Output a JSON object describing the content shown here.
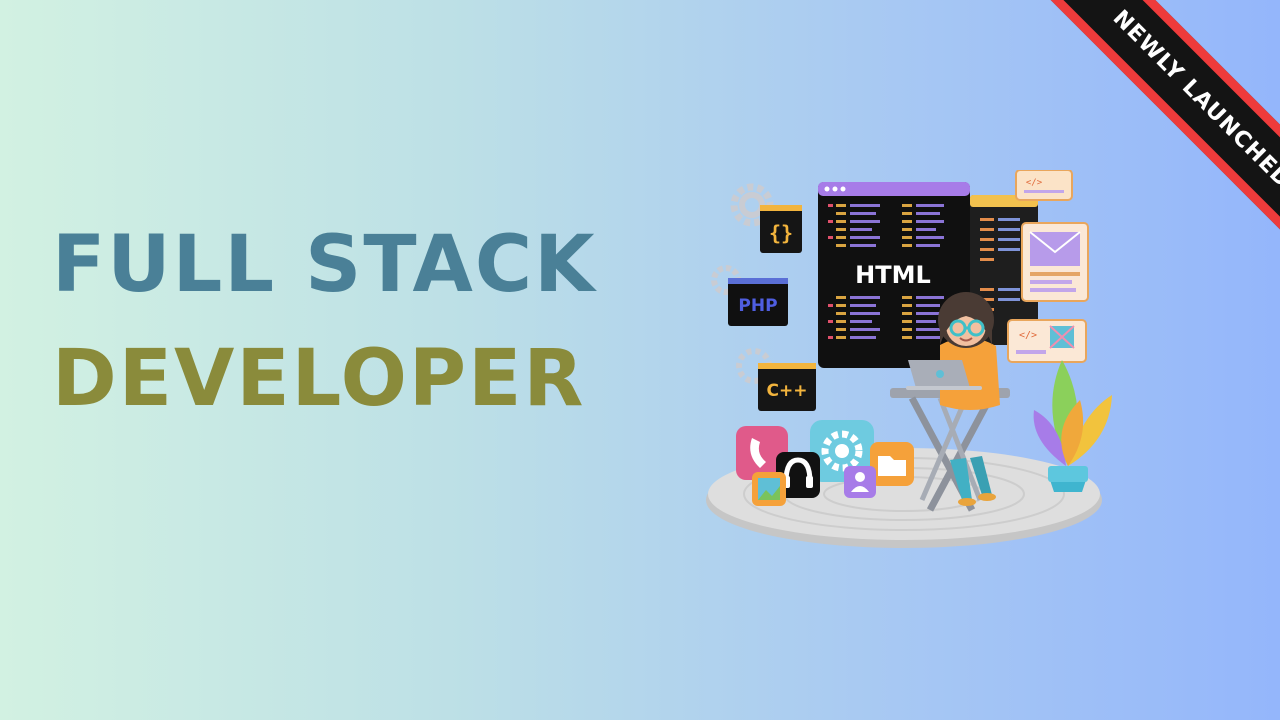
{
  "title": {
    "line1": "FULL STACK",
    "line2": "DEVELOPER"
  },
  "ribbon": {
    "label": "NEWLY LAUNCHED"
  },
  "illustration": {
    "main_window_label": "HTML",
    "badges": {
      "braces": "{}",
      "php": "PHP",
      "cpp": "C++",
      "code_tag": "</>"
    }
  },
  "colors": {
    "title_line1": "#4a8097",
    "title_line2": "#8a8b3b",
    "ribbon_bg": "#141414",
    "ribbon_border": "#ee3b3b",
    "window_header": "#a77ce8"
  }
}
